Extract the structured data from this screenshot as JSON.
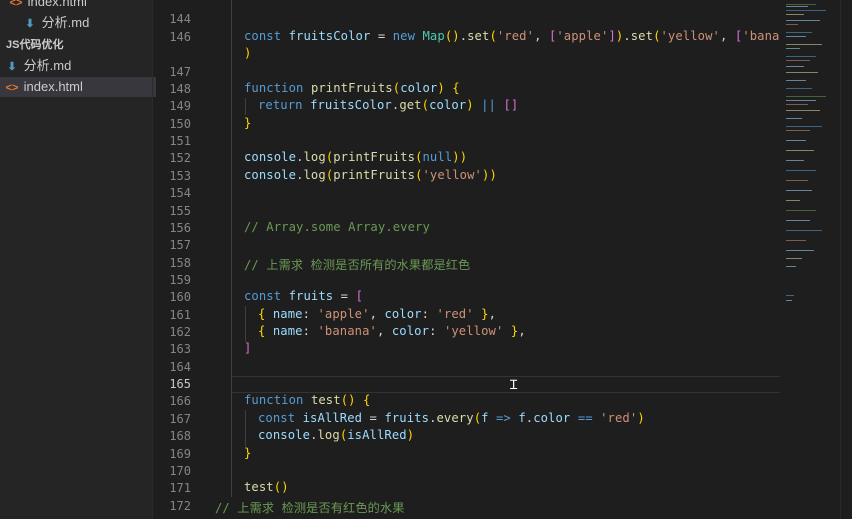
{
  "explorer": {
    "items": [
      {
        "name": "index.html",
        "icon": "html-file-icon",
        "type": "file"
      },
      {
        "name": "分析.md",
        "icon": "markdown-file-icon",
        "type": "file"
      },
      {
        "name": "JS代码优化",
        "icon": "chevron-down-icon",
        "type": "folder"
      },
      {
        "name": "分析.md",
        "icon": "markdown-file-icon",
        "type": "file"
      },
      {
        "name": "index.html",
        "icon": "html-file-icon",
        "type": "file",
        "selected": true
      }
    ]
  },
  "editor": {
    "current_line": 165,
    "lines": [
      {
        "n": 144,
        "text": ""
      },
      {
        "n": 146,
        "text": "const fruitsColor = new Map().set('red', ['apple']).set('yellow', ['banana']"
      },
      {
        "n": 146,
        "text": ")"
      },
      {
        "n": 147,
        "text": ""
      },
      {
        "n": 148,
        "text": "function printFruits(color) {"
      },
      {
        "n": 149,
        "text": "return fruitsColor.get(color) || []"
      },
      {
        "n": 150,
        "text": "}"
      },
      {
        "n": 151,
        "text": ""
      },
      {
        "n": 152,
        "text": "console.log(printFruits(null))"
      },
      {
        "n": 153,
        "text": "console.log(printFruits('yellow'))"
      },
      {
        "n": 154,
        "text": ""
      },
      {
        "n": 155,
        "text": ""
      },
      {
        "n": 156,
        "text": "// Array.some Array.every"
      },
      {
        "n": 157,
        "text": ""
      },
      {
        "n": 158,
        "text": "// 上需求 检测是否所有的水果都是红色"
      },
      {
        "n": 159,
        "text": ""
      },
      {
        "n": 160,
        "text": "const fruits = ["
      },
      {
        "n": 161,
        "text": "{ name: 'apple', color: 'red' },"
      },
      {
        "n": 162,
        "text": "{ name: 'banana', color: 'yellow' },"
      },
      {
        "n": 163,
        "text": "]"
      },
      {
        "n": 164,
        "text": ""
      },
      {
        "n": 165,
        "text": ""
      },
      {
        "n": 166,
        "text": "function test() {"
      },
      {
        "n": 167,
        "text": "const isAllRed = fruits.every(f => f.color == 'red')"
      },
      {
        "n": 168,
        "text": "console.log(isAllRed)"
      },
      {
        "n": 169,
        "text": "}"
      },
      {
        "n": 170,
        "text": ""
      },
      {
        "n": 171,
        "text": "test()"
      },
      {
        "n": 172,
        "text": "// 上需求 检测是否有红色的水果"
      }
    ]
  },
  "colors": {
    "keyword": "#569cd6",
    "function": "#dcdcaa",
    "variable": "#9cdcfe",
    "string": "#ce9178",
    "comment": "#6a9955",
    "bracket": "#ffd700"
  }
}
